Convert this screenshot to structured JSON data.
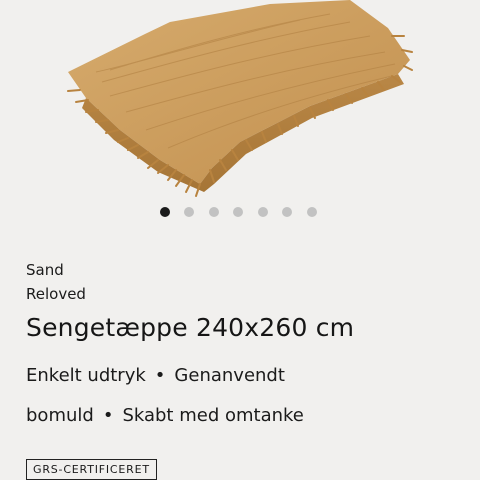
{
  "product": {
    "color": "Sand",
    "collection": "Reloved",
    "title": "Sengetæppe 240x260 cm",
    "features": [
      [
        "Enkelt udtryk",
        "Genanvendt"
      ],
      [
        "bomuld",
        "Skabt med omtanke"
      ]
    ],
    "separator": "•",
    "badge": "GRS-CERTIFICERET",
    "image_subject": "folded-sand-bedspread",
    "image_color": "#c99a5b"
  },
  "gallery": {
    "slide_count": 7,
    "active_index": 0
  }
}
